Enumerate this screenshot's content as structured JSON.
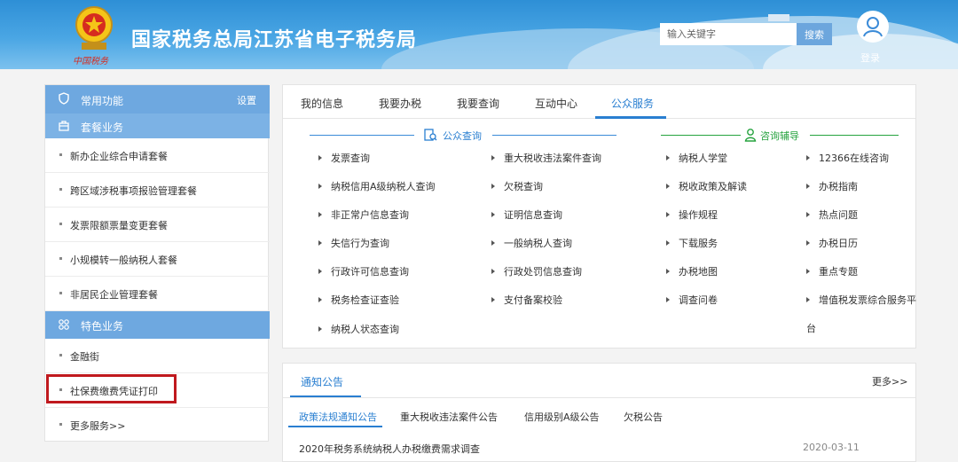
{
  "header": {
    "title": "国家税务总局江苏省电子税务局",
    "emblem_script": "中国税务",
    "search_placeholder": "输入关键字",
    "search_button": "搜索",
    "login": "登录"
  },
  "sidebar": {
    "common": {
      "label": "常用功能",
      "settings": "设置"
    },
    "package_header": "套餐业务",
    "package_items": [
      "新办企业综合申请套餐",
      "跨区域涉税事项报验管理套餐",
      "发票限额票量变更套餐",
      "小规模转一般纳税人套餐",
      "非居民企业管理套餐"
    ],
    "special_header": "特色业务",
    "special_items": [
      "金融街",
      "社保费缴费凭证打印",
      "更多服务>>"
    ]
  },
  "tabs": [
    "我的信息",
    "我要办税",
    "我要查询",
    "互动中心",
    "公众服务"
  ],
  "public_query": {
    "title": "公众查询",
    "col1": [
      "发票查询",
      "纳税信用A级纳税人查询",
      "非正常户信息查询",
      "失信行为查询",
      "行政许可信息查询",
      "税务检查证查验",
      "纳税人状态查询"
    ],
    "col2": [
      "重大税收违法案件查询",
      "欠税查询",
      "证明信息查询",
      "一般纳税人查询",
      "行政处罚信息查询",
      "支付备案校验"
    ]
  },
  "consult": {
    "title": "咨询辅导",
    "col3": [
      "纳税人学堂",
      "税收政策及解读",
      "操作规程",
      "下载服务",
      "办税地图",
      "调查问卷"
    ],
    "col4": [
      "12366在线咨询",
      "办税指南",
      "热点问题",
      "办税日历",
      "重点专题",
      "增值税发票综合服务平",
      "台"
    ]
  },
  "notice": {
    "title": "通知公告",
    "more": "更多>>",
    "subtabs": [
      "政策法规通知公告",
      "重大税收违法案件公告",
      "信用级别A级公告",
      "欠税公告"
    ],
    "rows": [
      {
        "title": "2020年税务系统纳税人办税缴费需求调查",
        "date": "2020-03-11"
      }
    ]
  },
  "colors": {
    "accent": "#2a7fd1",
    "sidebar_header": "#6ea8e0",
    "green": "#26a33f",
    "highlight": "#c0191e"
  }
}
